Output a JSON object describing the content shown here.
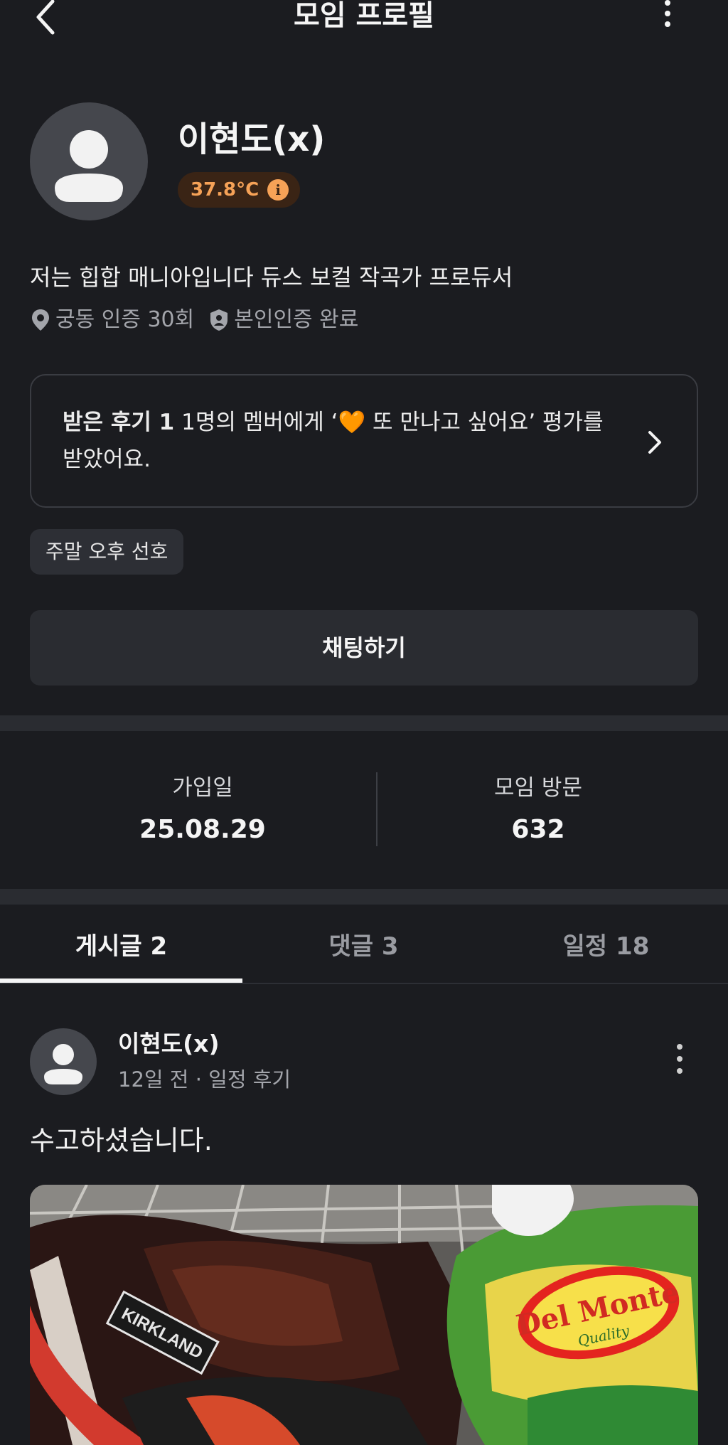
{
  "header": {
    "title": "모임 프로필",
    "back_icon": "chevron-left-icon",
    "more_icon": "more-vertical-icon"
  },
  "profile": {
    "nickname": "이현도(x)",
    "temperature": "37.8°C",
    "temperature_color": "#f6a257",
    "bio": "저는 힙합 매니아입니다 듀스 보컬 작곡가 프로듀서",
    "location_verify": "궁동 인증 30회",
    "identity_verify": "본인인증 완료"
  },
  "review": {
    "title": "받은 후기 1",
    "text_before": "1명의 멤버에게 ‘",
    "emoji": "🧡",
    "text_after": " 또 만나고 싶어요’ 평가를 받았어요."
  },
  "tag": "주말 오후 선호",
  "chat_button": "채팅하기",
  "stats": {
    "join_label": "가입일",
    "join_value": "25.08.29",
    "visit_label": "모임 방문",
    "visit_value": "632"
  },
  "tabs": [
    {
      "label": "게시글 2",
      "active": true
    },
    {
      "label": "댓글 3",
      "active": false
    },
    {
      "label": "일정 18",
      "active": false
    }
  ],
  "post": {
    "author": "이현도(x)",
    "time": "12일 전",
    "category": "일정 후기",
    "body": "수고하셨습니다.",
    "photo_brand": "Del Monte",
    "photo_brand_sub": "Quality",
    "photo_label": "KIRKLAND"
  }
}
